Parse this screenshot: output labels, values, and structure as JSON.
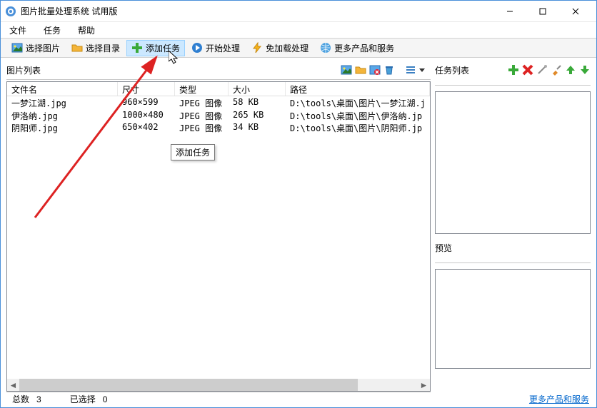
{
  "window": {
    "title": "图片批量处理系统 试用版"
  },
  "menus": {
    "file": "文件",
    "tasks": "任务",
    "help": "帮助"
  },
  "toolbar": {
    "select_pics": "选择图片",
    "select_dir": "选择目录",
    "add_task": "添加任务",
    "start": "开始处理",
    "noload": "免加载处理",
    "more": "更多产品和服务"
  },
  "tooltip": {
    "add_task": "添加任务"
  },
  "left_pane": {
    "title": "图片列表",
    "columns": {
      "name": "文件名",
      "dim": "尺寸",
      "type": "类型",
      "size": "大小",
      "path": "路径"
    },
    "rows": [
      {
        "name": "一梦江湖.jpg",
        "dim": "960×599",
        "type": "JPEG 图像",
        "size": "58 KB",
        "path": "D:\\tools\\桌面\\图片\\一梦江湖.j"
      },
      {
        "name": "伊洛纳.jpg",
        "dim": "1000×480",
        "type": "JPEG 图像",
        "size": "265 KB",
        "path": "D:\\tools\\桌面\\图片\\伊洛纳.jp"
      },
      {
        "name": "阴阳师.jpg",
        "dim": "650×402",
        "type": "JPEG 图像",
        "size": "34 KB",
        "path": "D:\\tools\\桌面\\图片\\阴阳师.jp"
      }
    ]
  },
  "statusbar": {
    "total_label": "总数",
    "total_value": "3",
    "selected_label": "已选择",
    "selected_value": "0"
  },
  "right_pane": {
    "tasks_title": "任务列表",
    "preview_title": "预览"
  },
  "footer": {
    "more_link": "更多产品和服务"
  },
  "icons": {
    "picture": "picture-icon",
    "folder": "folder-icon",
    "plus": "plus-icon",
    "play": "play-icon",
    "bolt": "bolt-icon",
    "globe": "globe-icon",
    "delete_img": "delete-image-icon",
    "trash": "trash-icon",
    "list": "list-icon",
    "cross": "cross-icon",
    "wand": "wand-icon",
    "brush": "brush-icon",
    "arrow_up": "arrow-up-icon",
    "arrow_down": "arrow-down-icon"
  }
}
